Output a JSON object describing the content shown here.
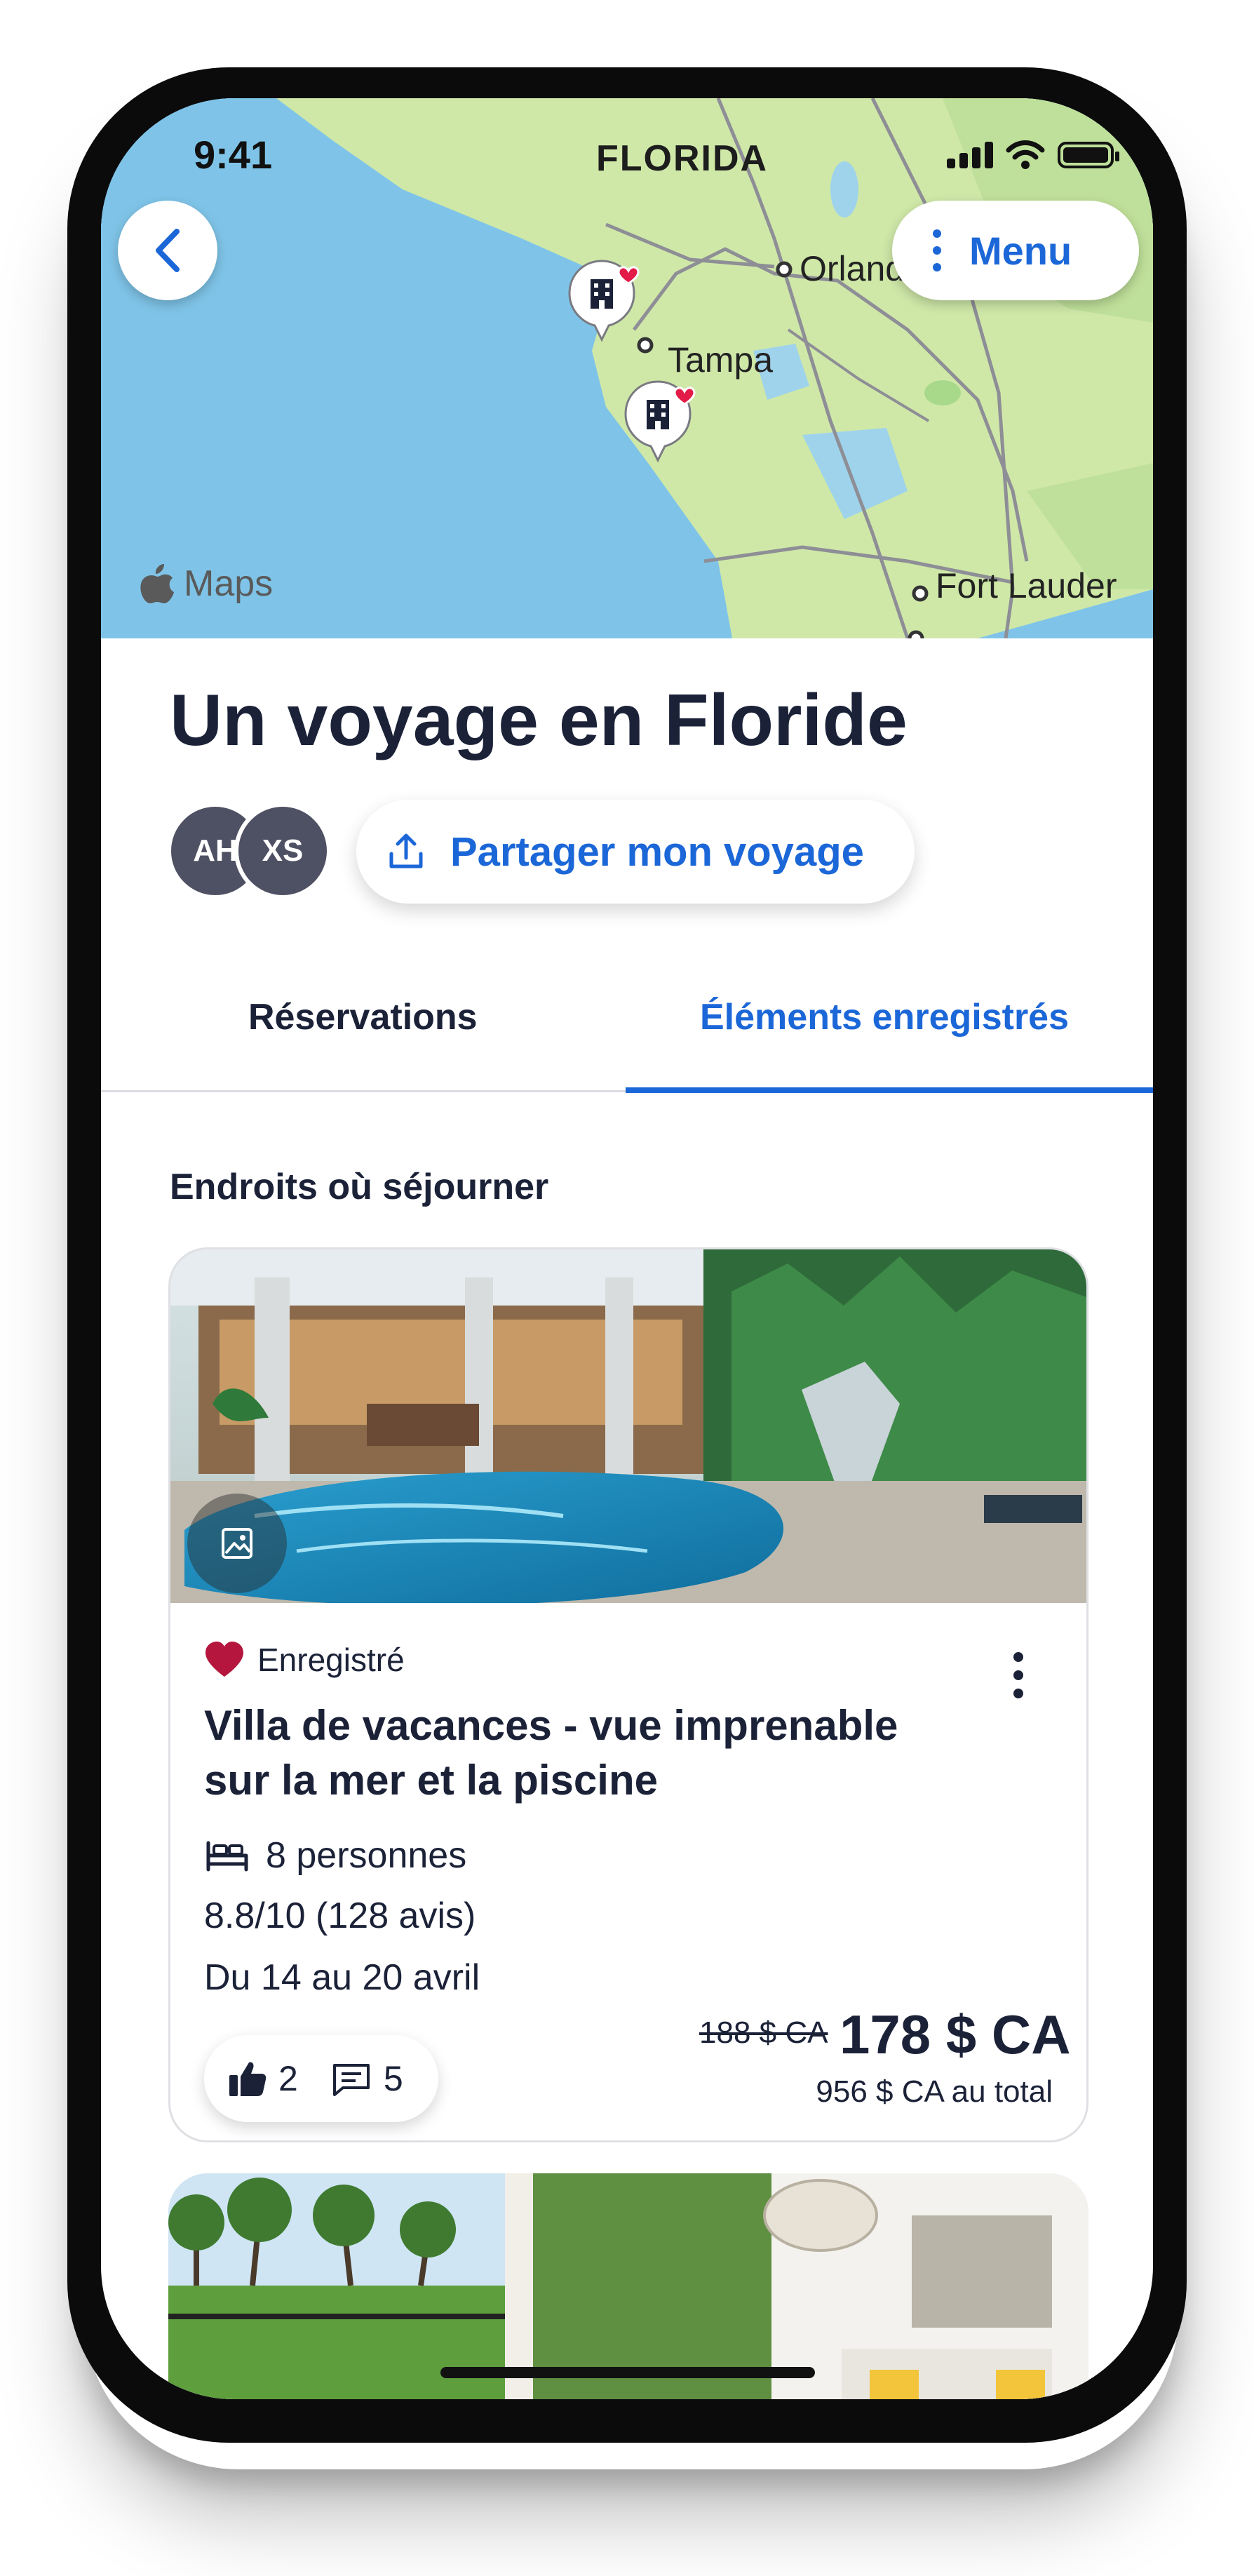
{
  "status_bar": {
    "time": "9:41"
  },
  "map": {
    "state_label": "FLORIDA",
    "cities": [
      "Orlando",
      "Tampa",
      "Fort Lauder"
    ],
    "attribution": "Maps"
  },
  "nav": {
    "menu_label": "Menu"
  },
  "trip": {
    "title": "Un voyage en Floride",
    "travelers": [
      "AH",
      "XS"
    ],
    "share_label": "Partager mon voyage"
  },
  "tabs": [
    {
      "label": "Réservations",
      "active": false
    },
    {
      "label": "Éléments enregistrés",
      "active": true
    }
  ],
  "section": {
    "title": "Endroits où séjourner"
  },
  "listing": {
    "saved_label": "Enregistré",
    "title": "Villa de vacances - vue imprenable sur la mer et la piscine",
    "guests": "8 personnes",
    "rating": "8.8/10",
    "reviews": "(128 avis)",
    "dates": "Du 14 au 20 avril",
    "likes": "2",
    "comments": "5",
    "old_price": "188 $ CA",
    "price": "178 $ CA",
    "total": "956 $ CA au total"
  },
  "colors": {
    "accent": "#1c67d8",
    "text": "#1b2238",
    "heart": "#b5163d"
  }
}
